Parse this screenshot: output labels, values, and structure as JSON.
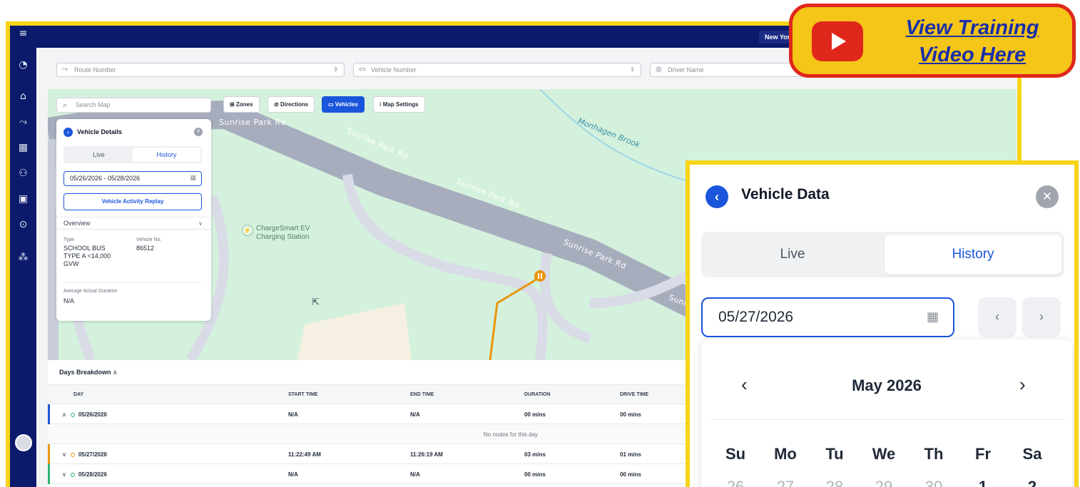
{
  "header": {
    "city": "New York"
  },
  "filters": {
    "route_placeholder": "Route Number",
    "vehicle_placeholder": "Vehicle Number",
    "driver_placeholder": "Driver Name"
  },
  "map": {
    "search_placeholder": "Search Map",
    "buttons": {
      "zones": "Zones",
      "directions": "Directions",
      "vehicles": "Vehicles",
      "settings": "Map Settings"
    },
    "roads": [
      "Sunrise Park Rd",
      "Sunrise Park Rd",
      "Sunrise Park Rd",
      "Sunrise Park Rd",
      "Sunrise Park Rd",
      "Sunr"
    ],
    "brook": "Monhagen Brook",
    "poi_line1": "ChargeSmart EV",
    "poi_line2": "Charging Station"
  },
  "vehicle_panel": {
    "title": "Vehicle Details",
    "tab_live": "Live",
    "tab_history": "History",
    "date_range": "05/26/2026 - 05/28/2026",
    "replay": "Vehicle Activity Replay",
    "overview": "Overview",
    "type_label": "Type",
    "type_line1": "SCHOOL BUS",
    "type_line2": "TYPE A <14,000",
    "type_line3": "GVW",
    "vehicle_no_label": "Vehicle No.",
    "vehicle_no": "86512",
    "avg_label": "Average Actual Duration",
    "avg_value": "N/A"
  },
  "days": {
    "title": "Days Breakdown",
    "columns": {
      "day": "DAY",
      "start": "START TIME",
      "end": "END TIME",
      "duration": "DURATION",
      "drive": "DRIVE TIME"
    },
    "rows": [
      {
        "day": "05/26/2026",
        "start": "N/A",
        "end": "N/A",
        "duration": "00 mins",
        "drive": "00 mins"
      },
      {
        "day": "05/27/2026",
        "start": "11:22:49 AM",
        "end": "11:26:19 AM",
        "duration": "03 mins",
        "drive": "01 mins"
      },
      {
        "day": "05/28/2026",
        "start": "N/A",
        "end": "N/A",
        "duration": "00 mins",
        "drive": "00 mins"
      }
    ],
    "no_routes": "No routes for this day"
  },
  "callout": {
    "line1": "View Training",
    "line2": "Video Here"
  },
  "zoom": {
    "title": "Vehicle Data",
    "tab_live": "Live",
    "tab_history": "History",
    "date": "05/27/2026",
    "month": "May  2026",
    "weekdays": [
      "Su",
      "Mo",
      "Tu",
      "We",
      "Th",
      "Fr",
      "Sa"
    ],
    "days": [
      "26",
      "27",
      "28",
      "29",
      "30",
      "1",
      "2"
    ]
  },
  "colors": {
    "accent": "#1a56db",
    "nav": "#0b1a6b",
    "frame": "#f7d417",
    "route": "#e8950c"
  }
}
